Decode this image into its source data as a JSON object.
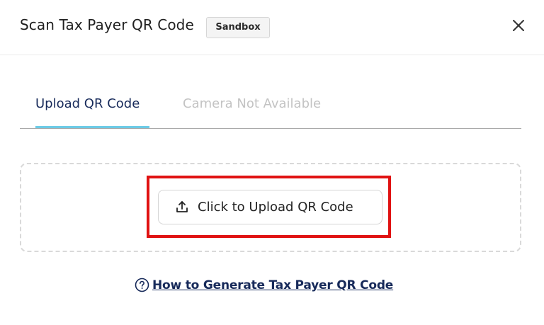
{
  "dialog": {
    "title": "Scan Tax Payer QR Code",
    "environment_badge": "Sandbox",
    "close_icon": "close-icon"
  },
  "tabs": [
    {
      "label": "Upload QR Code",
      "active": true,
      "enabled": true
    },
    {
      "label": "Camera Not Available",
      "active": false,
      "enabled": false
    }
  ],
  "upload": {
    "button_label": "Click to Upload QR Code",
    "icon": "upload-icon"
  },
  "help": {
    "link_label": "How to Generate Tax Payer QR Code",
    "icon": "help-circle-icon"
  },
  "colors": {
    "tab_active_text": "#172a5a",
    "tab_active_indicator": "#6ccbe6",
    "tab_disabled_text": "#c3c3c3",
    "highlight_box": "#e01212",
    "link_text": "#172a5a"
  }
}
